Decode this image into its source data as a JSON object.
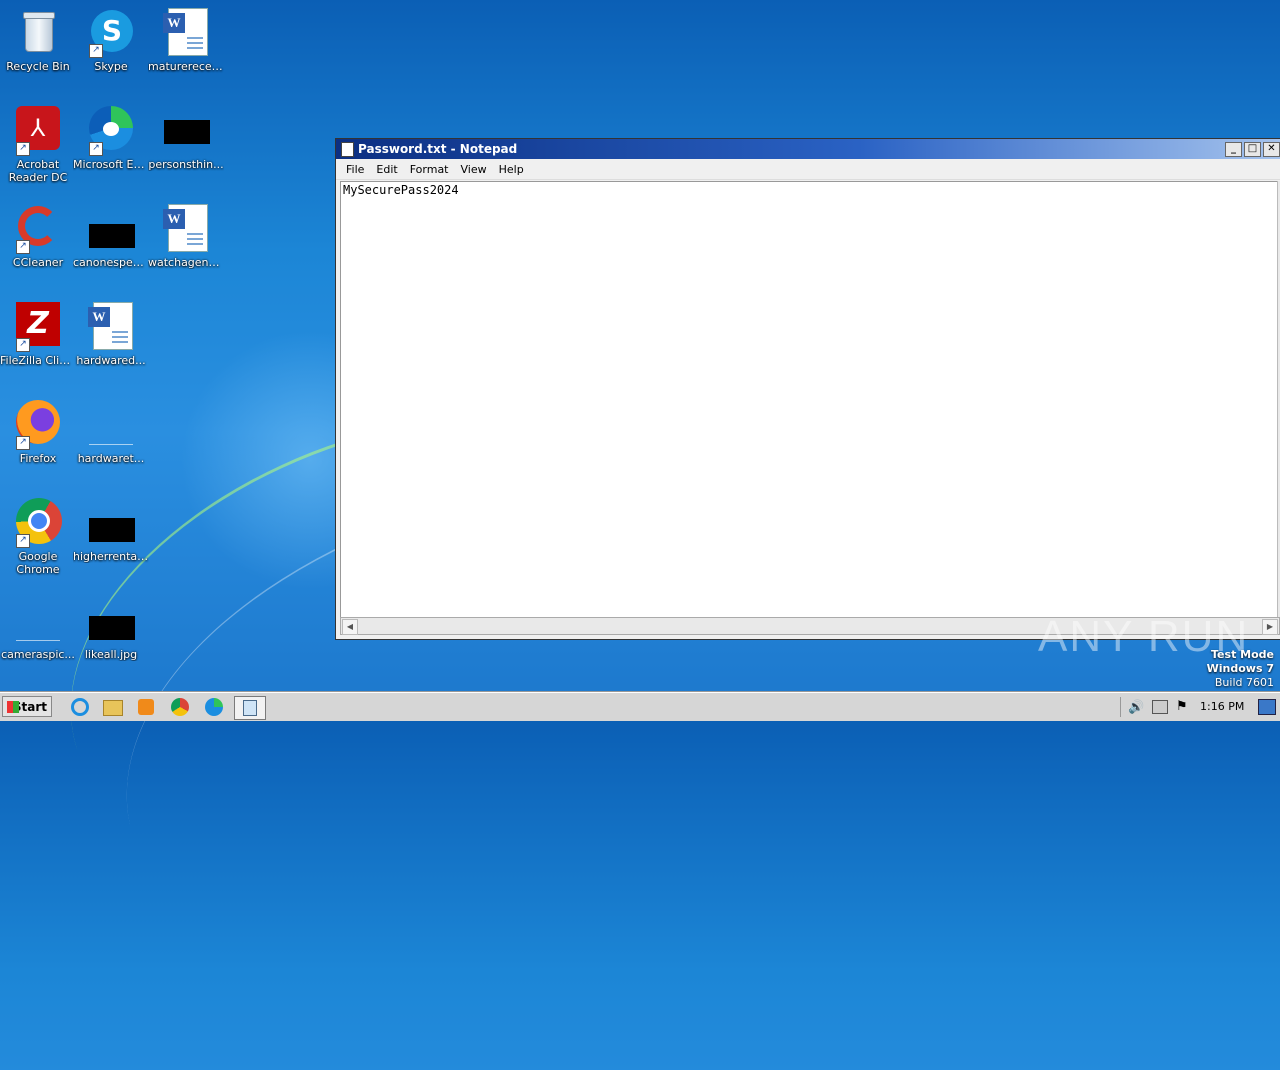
{
  "desktop": {
    "icons": [
      {
        "label": "Recycle Bin"
      },
      {
        "label": "Skype"
      },
      {
        "label": "maturerecei..."
      },
      {
        "label": "Acrobat Reader DC"
      },
      {
        "label": "Microsoft Edge"
      },
      {
        "label": "personsthin..."
      },
      {
        "label": "CCleaner"
      },
      {
        "label": "canonespec..."
      },
      {
        "label": "watchagenc..."
      },
      {
        "label": "FileZilla Client"
      },
      {
        "label": "hardwared..."
      },
      {
        "label": "Firefox"
      },
      {
        "label": "hardwaret..."
      },
      {
        "label": "Google Chrome"
      },
      {
        "label": "higherrental..."
      },
      {
        "label": "cameraspic..."
      },
      {
        "label": "likeall.jpg"
      }
    ]
  },
  "notepad": {
    "title": "Password.txt - Notepad",
    "menu": [
      "File",
      "Edit",
      "Format",
      "View",
      "Help"
    ],
    "content": "MySecurePass2024"
  },
  "watermark": {
    "text": "ANY RUN"
  },
  "system_info": {
    "line1": "Test Mode",
    "line2": "Windows 7",
    "line3": "Build 7601"
  },
  "taskbar": {
    "start_label": "Start",
    "clock": "1:16 PM"
  }
}
